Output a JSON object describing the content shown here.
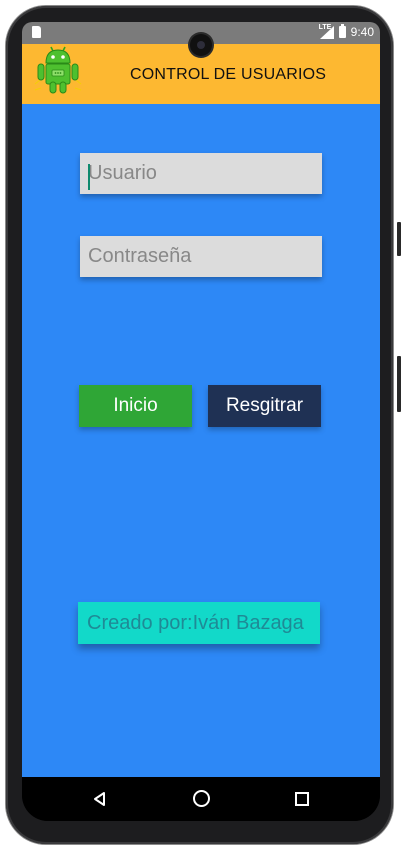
{
  "status_bar": {
    "network_label": "LTE",
    "time": "9:40"
  },
  "app_bar": {
    "title": "CONTROL DE USUARIOS",
    "logo_icon": "android-robot-icon",
    "background": "#fdb831"
  },
  "form": {
    "username_placeholder": "Usuario",
    "username_value": "",
    "password_placeholder": "Contraseña",
    "password_value": "",
    "background": "#2d88f6"
  },
  "buttons": {
    "login_label": "Inicio",
    "login_color": "#2fa636",
    "register_label": "Resgitrar",
    "register_color": "#1f3154"
  },
  "footer": {
    "credit": "Creado por:Iván Bazaga",
    "color": "#12d9c9"
  },
  "nav_bar": {
    "icons": [
      "back-icon",
      "home-icon",
      "recent-apps-icon"
    ]
  }
}
